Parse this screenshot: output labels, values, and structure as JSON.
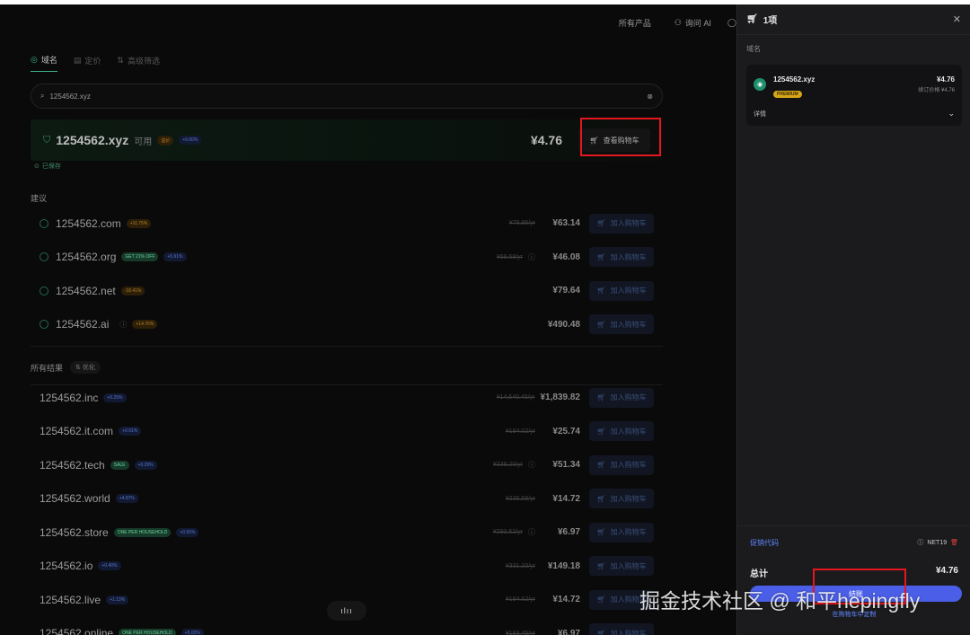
{
  "topnav": {
    "products": "所有产品",
    "ask_ai": "询问 AI",
    "more_icon": "circle-icon"
  },
  "tabs": [
    {
      "label": "域名",
      "active": true
    },
    {
      "label": "定价"
    },
    {
      "label": "高级筛选"
    }
  ],
  "search": {
    "value": "1254562.xyz"
  },
  "result": {
    "domain": "1254562.xyz",
    "status": "可用",
    "badge1": "溢价",
    "badge2": "+0.00%",
    "price": "¥4.76",
    "view_cart": "查看购物车",
    "save": "已保存"
  },
  "suggestions": {
    "title": "建议",
    "items": [
      {
        "domain": "1254562.com",
        "badges": [
          {
            "text": "+11.75%",
            "color": "orange"
          }
        ],
        "strike": "¥78.96/yr",
        "info": false,
        "price": "¥63.14",
        "add": "加入购物车"
      },
      {
        "domain": "1254562.org",
        "badges": [
          {
            "text": "GET 21% OFF",
            "color": "green"
          },
          {
            "text": "+5.91%",
            "color": "blue"
          }
        ],
        "strike": "¥69.68/yr",
        "info": true,
        "price": "¥46.08",
        "add": "加入购物车"
      },
      {
        "domain": "1254562.net",
        "badges": [
          {
            "text": "-18.41%",
            "color": "orange"
          }
        ],
        "strike": "",
        "info": false,
        "price": "¥79.64",
        "add": "加入购物车"
      },
      {
        "domain": "1254562.ai",
        "badges": [
          {
            "text": "+14.76%",
            "color": "orange"
          }
        ],
        "strike": "",
        "info": true,
        "price": "¥490.48",
        "add": "加入购物车",
        "name_info": true
      }
    ]
  },
  "all_results": {
    "title": "所有结果",
    "optimize": "优化",
    "items": [
      {
        "domain": "1254562.inc",
        "badges": [
          {
            "text": "+0.25%",
            "color": "blue"
          }
        ],
        "strike": "¥14,640.45/yr",
        "info": false,
        "price": "¥1,839.82",
        "add": "加入购物车"
      },
      {
        "domain": "1254562.it.com",
        "badges": [
          {
            "text": "+0.91%",
            "color": "blue"
          }
        ],
        "strike": "¥184.02/yr",
        "info": false,
        "price": "¥25.74",
        "add": "加入购物车"
      },
      {
        "domain": "1254562.tech",
        "badges": [
          {
            "text": "SALE",
            "color": "green"
          },
          {
            "text": "+0.29%",
            "color": "blue"
          }
        ],
        "strike": "¥339.20/yr",
        "info": true,
        "price": "¥51.34",
        "add": "加入购物车"
      },
      {
        "domain": "1254562.world",
        "badges": [
          {
            "text": "+4.87%",
            "color": "blue"
          }
        ],
        "strike": "¥235.58/yr",
        "info": false,
        "price": "¥14.72",
        "add": "加入购物车"
      },
      {
        "domain": "1254562.store",
        "badges": [
          {
            "text": "ONE PER HOUSEHOLD",
            "color": "green"
          },
          {
            "text": "+0.55%",
            "color": "blue"
          }
        ],
        "strike": "¥293.52/yr",
        "info": true,
        "price": "¥6.97",
        "add": "加入购物车"
      },
      {
        "domain": "1254562.io",
        "badges": [
          {
            "text": "+0.40%",
            "color": "blue"
          }
        ],
        "strike": "¥331.20/yr",
        "info": false,
        "price": "¥149.18",
        "add": "加入购物车"
      },
      {
        "domain": "1254562.live",
        "badges": [
          {
            "text": "+1.13%",
            "color": "blue"
          }
        ],
        "strike": "¥184.62/yr",
        "info": false,
        "price": "¥14.72",
        "add": "加入购物车"
      },
      {
        "domain": "1254562.online",
        "badges": [
          {
            "text": "ONE PER HOUSEHOLD",
            "color": "green"
          },
          {
            "text": "+5.02%",
            "color": "blue"
          }
        ],
        "strike": "¥183.45/yr",
        "info": false,
        "price": "¥6.97",
        "add": "加入购物车"
      }
    ]
  },
  "cart": {
    "title": "1项",
    "section": "域名",
    "item": {
      "domain": "1254562.xyz",
      "badge": "PREMIUM",
      "price": "¥4.76",
      "renew": "续订价格 ¥4.76",
      "details": "详情"
    },
    "promo_label": "促销代码",
    "promo_code": "NET19",
    "total_label": "总计",
    "total_value": "¥4.76",
    "checkout": "结账",
    "customize": "在购物车中定制"
  },
  "float_button": "ılıı",
  "watermark": "掘金技术社区 @ 和平hepingfly",
  "colors": {
    "accent_green": "#3fae8a",
    "accent_blue": "#4a5ee8",
    "highlight_red": "#e5161e"
  }
}
